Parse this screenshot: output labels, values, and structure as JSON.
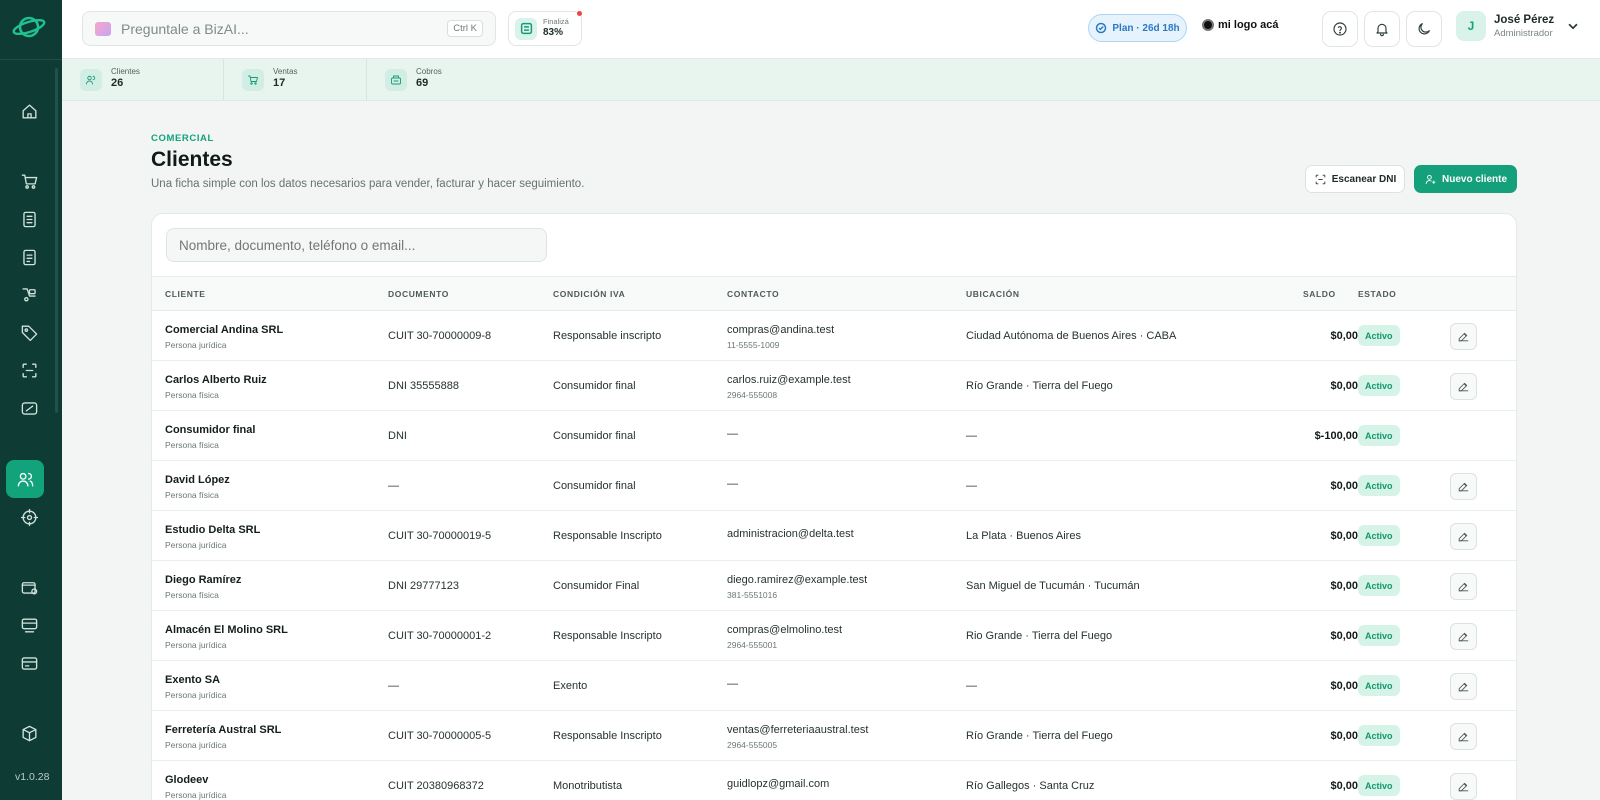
{
  "app": {
    "version": "v1.0.28"
  },
  "topbar": {
    "search_placeholder": "Preguntale a BizAI...",
    "search_shortcut": "Ctrl K",
    "progress_label": "Finalizá",
    "progress_value": "83%",
    "plan_label": "Plan · 26d 18h",
    "brand_label": "mi logo acá",
    "user_initial": "J",
    "user_name": "José Pérez",
    "user_role": "Administrador"
  },
  "stats": [
    {
      "label": "Clientes",
      "value": "26"
    },
    {
      "label": "Ventas",
      "value": "17"
    },
    {
      "label": "Cobros",
      "value": "69"
    }
  ],
  "page": {
    "section": "COMERCIAL",
    "title": "Clientes",
    "subtitle": "Una ficha simple con los datos necesarios para vender, facturar y hacer seguimiento.",
    "scan_button": "Escanear DNI",
    "new_button": "Nuevo cliente",
    "filter_placeholder": "Nombre, documento, teléfono o email..."
  },
  "table": {
    "headers": [
      "CLIENTE",
      "DOCUMENTO",
      "CONDICIÓN IVA",
      "CONTACTO",
      "UBICACIÓN",
      "SALDO",
      "ESTADO"
    ],
    "rows": [
      {
        "name": "Comercial Andina SRL",
        "type": "Persona jurídica",
        "doc": "CUIT 30-70000009-8",
        "iva": "Responsable inscripto",
        "email": "compras@andina.test",
        "phone": "11-5555-1009",
        "loc": "Ciudad Autónoma de Buenos Aires · CABA",
        "saldo": "$0,00",
        "estado": "Activo",
        "editable": true
      },
      {
        "name": "Carlos Alberto Ruiz",
        "type": "Persona física",
        "doc": "DNI 35555888",
        "iva": "Consumidor final",
        "email": "carlos.ruiz@example.test",
        "phone": "2964-555008",
        "loc": "Río Grande · Tierra del Fuego",
        "saldo": "$0,00",
        "estado": "Activo",
        "editable": true
      },
      {
        "name": "Consumidor final",
        "type": "Persona física",
        "doc": "DNI",
        "iva": "Consumidor final",
        "email": "—",
        "phone": "",
        "loc": "—",
        "saldo": "$-100,00",
        "estado": "Activo",
        "editable": false
      },
      {
        "name": "David López",
        "type": "Persona física",
        "doc": "—",
        "iva": "Consumidor final",
        "email": "—",
        "phone": "",
        "loc": "—",
        "saldo": "$0,00",
        "estado": "Activo",
        "editable": true
      },
      {
        "name": "Estudio Delta SRL",
        "type": "Persona jurídica",
        "doc": "CUIT 30-70000019-5",
        "iva": "Responsable Inscripto",
        "email": "administracion@delta.test",
        "phone": "",
        "loc": "La Plata · Buenos Aires",
        "saldo": "$0,00",
        "estado": "Activo",
        "editable": true
      },
      {
        "name": "Diego Ramírez",
        "type": "Persona física",
        "doc": "DNI 29777123",
        "iva": "Consumidor Final",
        "email": "diego.ramirez@example.test",
        "phone": "381-5551016",
        "loc": "San Miguel de Tucumán · Tucumán",
        "saldo": "$0,00",
        "estado": "Activo",
        "editable": true
      },
      {
        "name": "Almacén El Molino SRL",
        "type": "Persona jurídica",
        "doc": "CUIT 30-70000001-2",
        "iva": "Responsable Inscripto",
        "email": "compras@elmolino.test",
        "phone": "2964-555001",
        "loc": "Rio Grande · Tierra del Fuego",
        "saldo": "$0,00",
        "estado": "Activo",
        "editable": true
      },
      {
        "name": "Exento SA",
        "type": "Persona jurídica",
        "doc": "—",
        "iva": "Exento",
        "email": "—",
        "phone": "",
        "loc": "—",
        "saldo": "$0,00",
        "estado": "Activo",
        "editable": true
      },
      {
        "name": "Ferretería Austral SRL",
        "type": "Persona jurídica",
        "doc": "CUIT 30-70000005-5",
        "iva": "Responsable Inscripto",
        "email": "ventas@ferreteriaaustral.test",
        "phone": "2964-555005",
        "loc": "Río Grande · Tierra del Fuego",
        "saldo": "$0,00",
        "estado": "Activo",
        "editable": true
      },
      {
        "name": "Glodeev",
        "type": "Persona jurídica",
        "doc": "CUIT 20380968372",
        "iva": "Monotributista",
        "email": "guidlopz@gmail.com",
        "phone": "",
        "loc": "Río Gallegos · Santa Cruz",
        "saldo": "$0,00",
        "estado": "Activo",
        "editable": true
      }
    ]
  },
  "colors": {
    "sidebar": "#0e3b33",
    "accent": "#13a07a",
    "plan": "#2a7ac4"
  }
}
